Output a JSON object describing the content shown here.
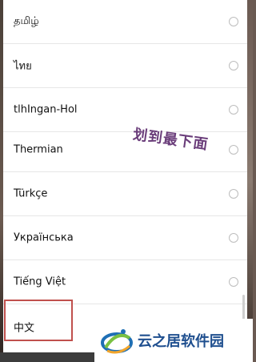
{
  "languages": [
    {
      "label": "தமிழ்"
    },
    {
      "label": "ไทย"
    },
    {
      "label": "tlhIngan-Hol"
    },
    {
      "label": "Thermian"
    },
    {
      "label": "Türkçe"
    },
    {
      "label": "Українська"
    },
    {
      "label": "Tiếng Việt"
    },
    {
      "label": "中文"
    }
  ],
  "annotation_text": "划到最下面",
  "watermark_text": "云之居软件园",
  "colors": {
    "highlight_border": "#c0504d",
    "annotation": "#6a3d7a",
    "watermark": "#1f4f8f"
  }
}
